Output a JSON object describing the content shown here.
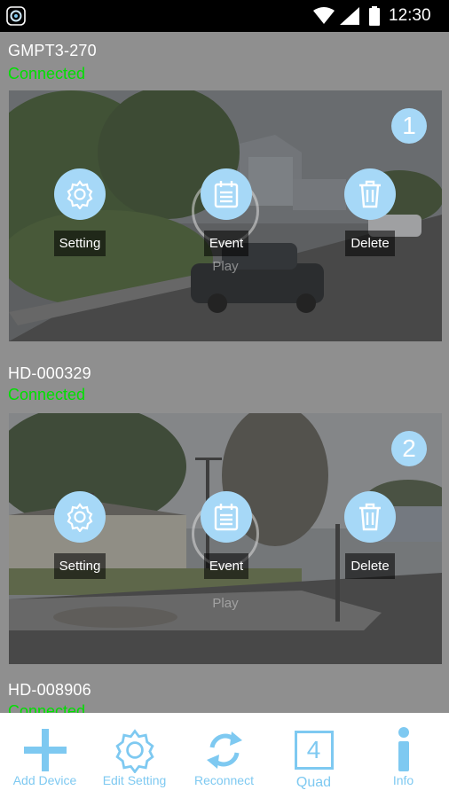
{
  "status_bar": {
    "time": "12:30"
  },
  "devices": [
    {
      "name": "GMPT3-270",
      "status": "Connected",
      "channel_badge": "1",
      "actions": {
        "setting": "Setting",
        "event": "Event",
        "delete": "Delete",
        "play": "Play"
      }
    },
    {
      "name": "HD-000329",
      "status": "Connected",
      "channel_badge": "2",
      "actions": {
        "setting": "Setting",
        "event": "Event",
        "delete": "Delete",
        "play": "Play"
      }
    },
    {
      "name": "HD-008906",
      "status": "Connected"
    }
  ],
  "bottom_bar": {
    "add_device": "Add Device",
    "edit_setting": "Edit Setting",
    "reconnect": "Reconnect",
    "quad": "Quad",
    "quad_digit": "4",
    "info": "Info"
  },
  "colors": {
    "accent": "#7ec9f1",
    "action_fill": "#a6d8f7",
    "connected": "#00e000"
  }
}
